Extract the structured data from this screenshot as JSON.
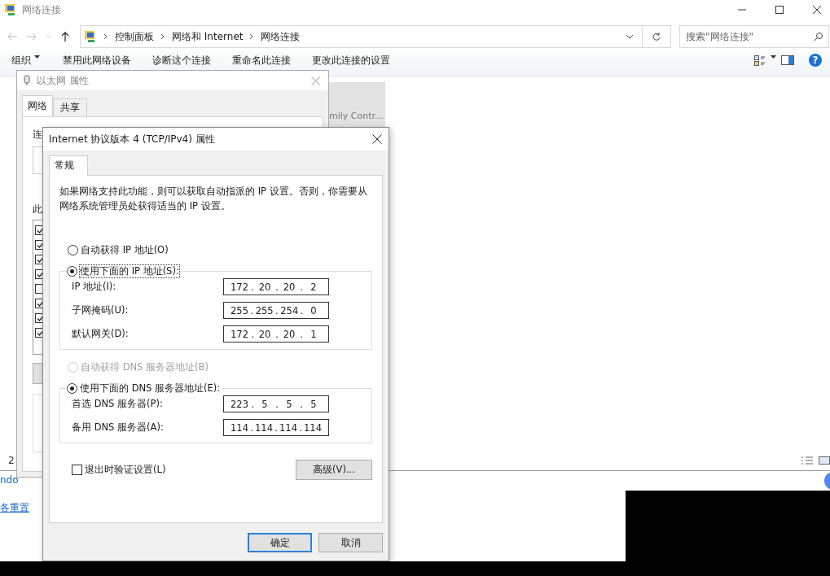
{
  "explorer": {
    "title": "网络连接",
    "breadcrumb": [
      "控制面板",
      "网络和 Internet",
      "网络连接"
    ],
    "search": {
      "placeholder": "搜索\"网络连接\""
    },
    "toolbar": [
      "组织",
      "禁用此网络设备",
      "诊断这个连接",
      "重命名此连接",
      "更改此连接的设置"
    ],
    "help": "?",
    "tile_label": "mily Contr...",
    "status_count": "2"
  },
  "background_window": {
    "texts": [
      "ndo"
    ],
    "link": "各重置"
  },
  "ethernet_dialog": {
    "title": "以太网 属性",
    "tabs": [
      {
        "label": "网络",
        "selected": true
      },
      {
        "label": "共享",
        "selected": false
      }
    ],
    "label_1": "连",
    "label_2": "此",
    "components": [
      {
        "checked": true
      },
      {
        "checked": true
      },
      {
        "checked": true
      },
      {
        "checked": true
      },
      {
        "checked": false
      },
      {
        "checked": true
      },
      {
        "checked": true
      },
      {
        "checked": true
      }
    ]
  },
  "ipv4_dialog": {
    "title": "Internet 协议版本 4 (TCP/IPv4) 属性",
    "tab": "常规",
    "description": "如果网络支持此功能，则可以获取自动指派的 IP 设置。否则，你需要从网络系统管理员处获得适当的 IP 设置。",
    "octet_separator": ".",
    "ip_options": [
      {
        "label": "自动获得 IP 地址(O)",
        "selected": false,
        "disabled": false
      },
      {
        "label": "使用下面的 IP 地址(S):",
        "selected": true,
        "disabled": false
      }
    ],
    "ip_fields": [
      {
        "label": "IP 地址(I):",
        "octets": [
          "172",
          "20",
          "20",
          "2"
        ]
      },
      {
        "label": "子网掩码(U):",
        "octets": [
          "255",
          "255",
          "254",
          "0"
        ]
      },
      {
        "label": "默认网关(D):",
        "octets": [
          "172",
          "20",
          "20",
          "1"
        ]
      }
    ],
    "dns_options": [
      {
        "label": "自动获得 DNS 服务器地址(B)",
        "selected": false,
        "disabled": true
      },
      {
        "label": "使用下面的 DNS 服务器地址(E):",
        "selected": true,
        "disabled": false
      }
    ],
    "dns_fields": [
      {
        "label": "首选 DNS 服务器(P):",
        "octets": [
          "223",
          "5",
          "5",
          "5"
        ]
      },
      {
        "label": "备用 DNS 服务器(A):",
        "octets": [
          "114",
          "114",
          "114",
          "114"
        ]
      }
    ],
    "validate": {
      "label": "退出时验证设置(L)",
      "checked": false
    },
    "advanced_button": "高级(V)...",
    "buttons": [
      {
        "label": "确定",
        "default": true
      },
      {
        "label": "取消",
        "default": false
      }
    ]
  }
}
